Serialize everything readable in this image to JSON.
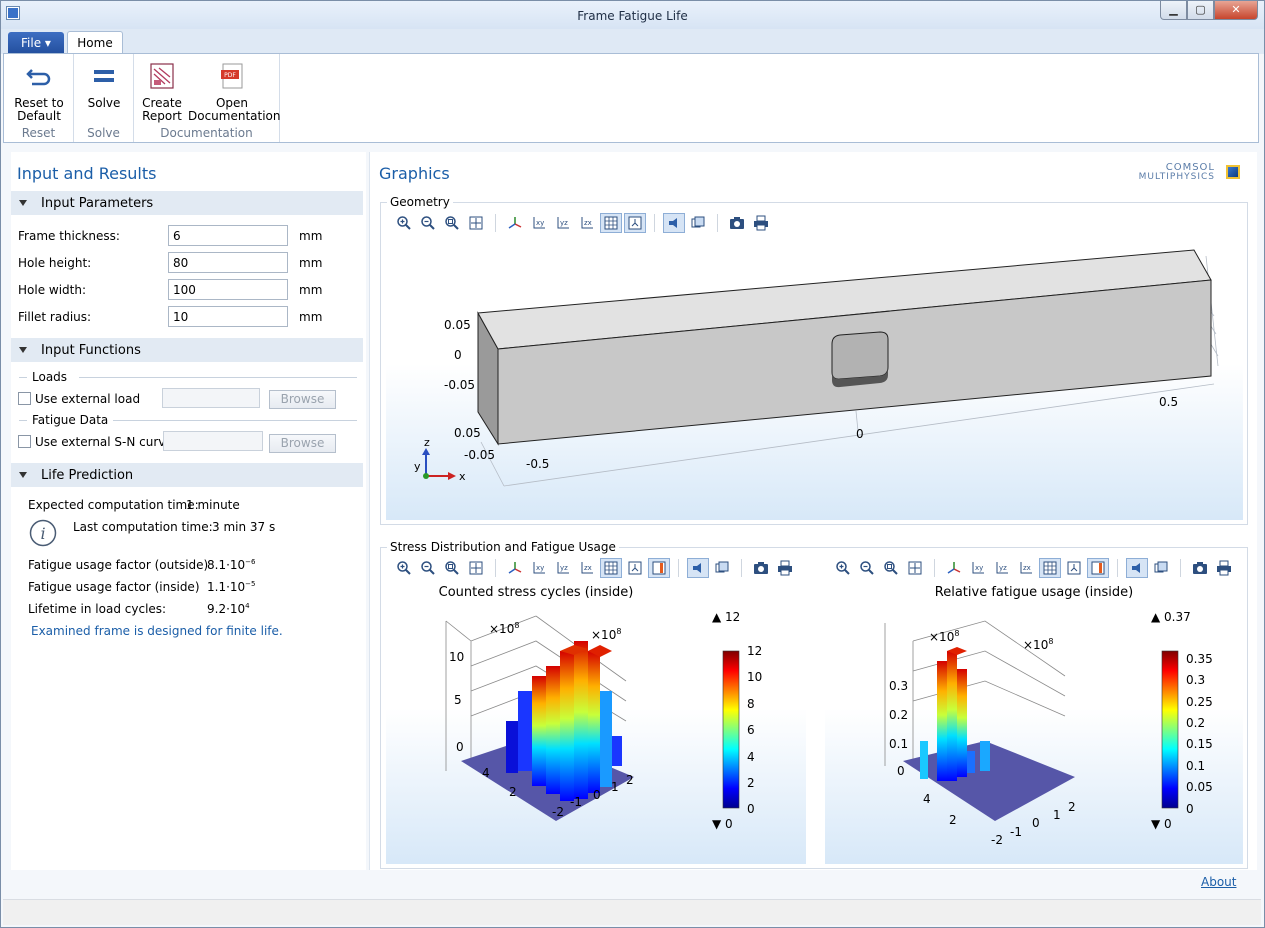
{
  "window": {
    "title": "Frame Fatigue Life"
  },
  "tabs": {
    "file": "File ▾",
    "home": "Home"
  },
  "ribbon": {
    "groups": [
      {
        "label": "Reset",
        "buttons": [
          {
            "label": "Reset to Default",
            "lines": [
              "Reset to",
              "Default"
            ],
            "icon": "undo-arrow-icon"
          }
        ]
      },
      {
        "label": "Solve",
        "buttons": [
          {
            "label": "Solve",
            "lines": [
              "Solve"
            ],
            "icon": "equals-icon"
          }
        ]
      },
      {
        "label": "Documentation",
        "buttons": [
          {
            "label": "Create Report",
            "lines": [
              "Create",
              "Report"
            ],
            "icon": "report-icon"
          },
          {
            "label": "Open Documentation",
            "lines": [
              "Open",
              "Documentation"
            ],
            "icon": "pdf-icon"
          }
        ]
      }
    ]
  },
  "left": {
    "title": "Input and Results",
    "input_parameters": {
      "heading": "Input Parameters",
      "rows": [
        {
          "label": "Frame thickness:",
          "value": "6",
          "unit": "mm"
        },
        {
          "label": "Hole height:",
          "value": "80",
          "unit": "mm"
        },
        {
          "label": "Hole width:",
          "value": "100",
          "unit": "mm"
        },
        {
          "label": "Fillet radius:",
          "value": "10",
          "unit": "mm"
        }
      ]
    },
    "input_functions": {
      "heading": "Input Functions",
      "loads_label": "Loads",
      "use_external_load": "Use external load",
      "fatigue_label": "Fatigue Data",
      "use_external_sn": "Use external S-N curve",
      "browse": "Browse"
    },
    "life_prediction": {
      "heading": "Life Prediction",
      "expected_label": "Expected computation time:",
      "expected_value": "1 minute",
      "last_label": "Last computation time:",
      "last_value": "3 min 37 s",
      "results": [
        {
          "label": "Fatigue usage factor (outside)",
          "mantissa": "8.1·10",
          "exp": "−6"
        },
        {
          "label": "Fatigue usage factor (inside)",
          "mantissa": "1.1·10",
          "exp": "−5"
        },
        {
          "label": "Lifetime in load cycles:",
          "mantissa": "9.2·10",
          "exp": "4"
        }
      ],
      "message": "Examined frame is designed for finite life."
    }
  },
  "right": {
    "title": "Graphics",
    "logo_line1": "COMSOL",
    "logo_line2": "MULTIPHYSICS",
    "geometry": {
      "label": "Geometry",
      "z_ticks": [
        "0.05",
        "0",
        "-0.05"
      ],
      "y_ticks": [
        "0.05",
        "-0.05"
      ],
      "x_ticks": [
        "-0.5",
        "0",
        "0.5"
      ],
      "axes": {
        "x": "x",
        "y": "y",
        "z": "z"
      }
    },
    "stress": {
      "label": "Stress Distribution and Fatigue Usage",
      "plot1": {
        "title": "Counted stress cycles (inside)",
        "mult_left": "×10",
        "mult_exp": "8",
        "mult_right": "×10",
        "z_ticks": [
          "10",
          "5",
          "0"
        ],
        "y_ticks": [
          "4",
          "2"
        ],
        "x_ticks": [
          "-2",
          "-1",
          "0",
          "1",
          "2"
        ],
        "legend_max": "▲ 12",
        "legend_min": "▼ 0",
        "colorbar_ticks": [
          "12",
          "10",
          "8",
          "6",
          "4",
          "2",
          "0"
        ]
      },
      "plot2": {
        "title": "Relative fatigue usage (inside)",
        "mult_left": "×10",
        "mult_exp": "8",
        "mult_right": "×10",
        "z_ticks": [
          "0.3",
          "0.2",
          "0.1",
          "0"
        ],
        "y_ticks": [
          "4",
          "2"
        ],
        "x_ticks": [
          "-2",
          "-1",
          "0",
          "1",
          "2"
        ],
        "legend_max": "▲ 0.37",
        "legend_min": "▼ 0",
        "colorbar_ticks": [
          "0.35",
          "0.3",
          "0.25",
          "0.2",
          "0.15",
          "0.1",
          "0.05",
          "0"
        ]
      }
    }
  },
  "footer": {
    "about": "About"
  }
}
